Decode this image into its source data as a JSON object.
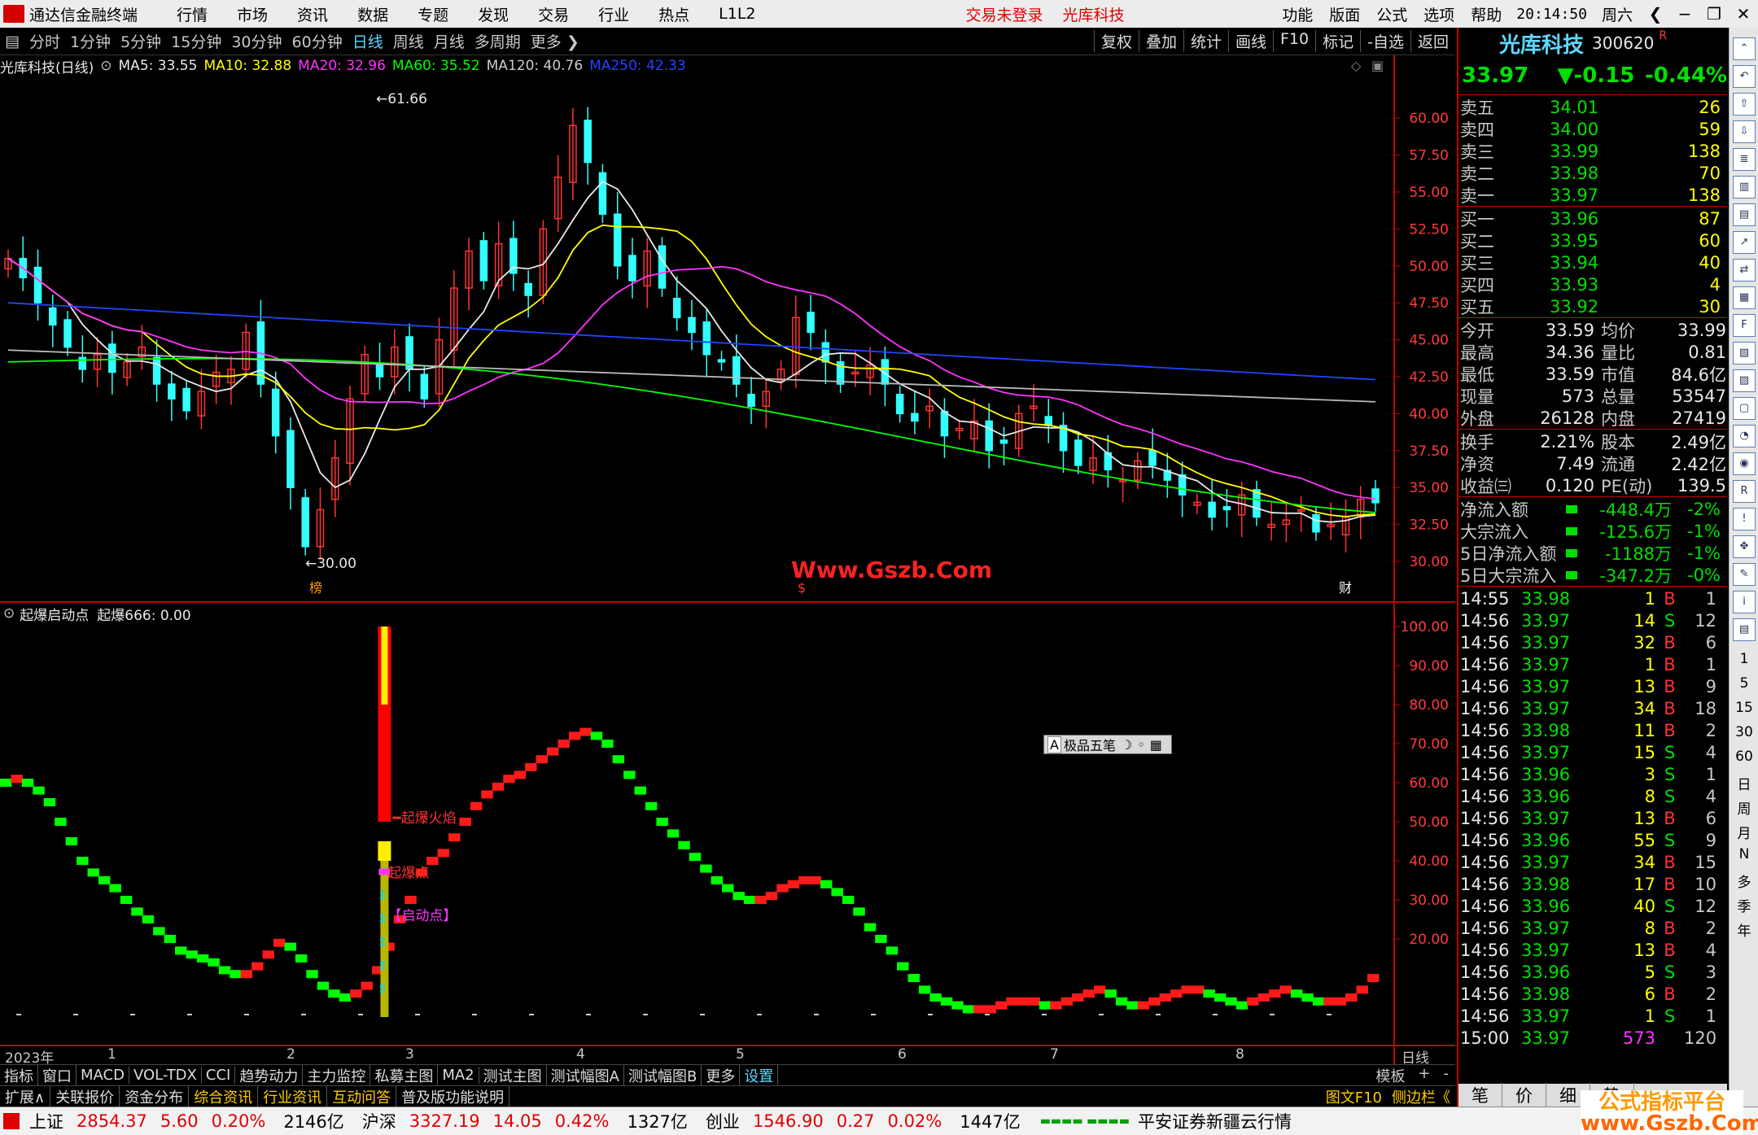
{
  "menubar": {
    "app_title": "通达信金融终端",
    "items": [
      "行情",
      "市场",
      "资讯",
      "数据",
      "专题",
      "发现",
      "交易",
      "行业",
      "热点",
      "L1L2"
    ],
    "status_notice": "交易未登录",
    "stock_name": "光库科技",
    "right_items": [
      "功能",
      "版面",
      "公式",
      "选项",
      "帮助"
    ],
    "clock": "20:14:50",
    "weekday": "周六"
  },
  "periodbar": {
    "periods": [
      "分时",
      "1分钟",
      "5分钟",
      "15分钟",
      "30分钟",
      "60分钟",
      "日线",
      "周线",
      "月线",
      "多周期",
      "更多"
    ],
    "active": "日线",
    "tools": [
      "复权",
      "叠加",
      "统计",
      "画线",
      "F10",
      "标记",
      "-自选",
      "返回"
    ]
  },
  "chart_info": {
    "title": "光库科技(日线)",
    "ma": [
      {
        "label": "MA5: 33.55",
        "color": "#e8e8e8"
      },
      {
        "label": "MA10: 32.88",
        "color": "#ffff00"
      },
      {
        "label": "MA20: 32.96",
        "color": "#ff33ff"
      },
      {
        "label": "MA60: 35.52",
        "color": "#00ff00"
      },
      {
        "label": "MA120: 40.76",
        "color": "#cccccc"
      },
      {
        "label": "MA250: 42.33",
        "color": "#2244ff"
      }
    ]
  },
  "watermark": "Www.Gszb.Com",
  "sub_chart": {
    "title": "起爆启动点",
    "value_label": "起爆666: 0.00",
    "annotations": [
      "起爆火焰",
      "起爆点",
      "【启动点】"
    ],
    "popup": "极品五笔"
  },
  "date_axis": {
    "labels": [
      "2023年",
      "1",
      "2",
      "3",
      "4",
      "5",
      "6",
      "7",
      "8",
      "日线"
    ]
  },
  "tabs1": [
    "指标",
    "窗口",
    "MACD",
    "VOL-TDX",
    "CCI",
    "趋势动力",
    "主力监控",
    "私募主图",
    "MA2",
    "测试主图",
    "测试幅图A",
    "测试幅图B",
    "更多",
    "设置"
  ],
  "tabs1_tail": [
    "模板",
    "+",
    "-"
  ],
  "tabs2": [
    "扩展∧",
    "关联报价",
    "资金分布",
    "综合资讯",
    "行业资讯",
    "互动问答",
    "普及版功能说明"
  ],
  "tabs2_tail": [
    "图文F10",
    "侧边栏《"
  ],
  "quote": {
    "name": "光库科技",
    "code": "300620",
    "price": "33.97",
    "change": "▼-0.15",
    "pct": "-0.44%",
    "asks": [
      {
        "label": "卖五",
        "price": "34.01",
        "vol": "26"
      },
      {
        "label": "卖四",
        "price": "34.00",
        "vol": "59"
      },
      {
        "label": "卖三",
        "price": "33.99",
        "vol": "138"
      },
      {
        "label": "卖二",
        "price": "33.98",
        "vol": "70"
      },
      {
        "label": "卖一",
        "price": "33.97",
        "vol": "138"
      }
    ],
    "bids": [
      {
        "label": "买一",
        "price": "33.96",
        "vol": "87"
      },
      {
        "label": "买二",
        "price": "33.95",
        "vol": "60"
      },
      {
        "label": "买三",
        "price": "33.94",
        "vol": "40"
      },
      {
        "label": "买四",
        "price": "33.93",
        "vol": "4"
      },
      {
        "label": "买五",
        "price": "33.92",
        "vol": "30"
      }
    ],
    "stats": [
      {
        "l1": "今开",
        "v1": "33.59",
        "l2": "均价",
        "v2": "33.99"
      },
      {
        "l1": "最高",
        "v1": "34.36",
        "l2": "量比",
        "v2": "0.81"
      },
      {
        "l1": "最低",
        "v1": "33.59",
        "l2": "市值",
        "v2": "84.6亿"
      },
      {
        "l1": "现量",
        "v1": "573",
        "l2": "总量",
        "v2": "53547"
      },
      {
        "l1": "外盘",
        "v1": "26128",
        "l2": "内盘",
        "v2": "27419"
      }
    ],
    "fund": [
      {
        "l1": "换手",
        "v1": "2.21%",
        "l2": "股本",
        "v2": "2.49亿"
      },
      {
        "l1": "净资",
        "v1": "7.49",
        "l2": "流通",
        "v2": "2.42亿"
      },
      {
        "l1": "收益㈢",
        "v1": "0.120",
        "l2": "PE(动)",
        "v2": "139.5"
      }
    ],
    "flows": [
      {
        "label": "净流入额",
        "value": "-448.4万",
        "pct": "-2%"
      },
      {
        "label": "大宗流入",
        "value": "-125.6万",
        "pct": "-1%"
      },
      {
        "label": "5日净流入额",
        "value": "-1188万",
        "pct": "-1%"
      },
      {
        "label": "5日大宗流入",
        "value": "-347.2万",
        "pct": "-0%"
      }
    ],
    "ticks": [
      {
        "t": "14:55",
        "p": "33.98",
        "v": "1",
        "bs": "B",
        "n": "1"
      },
      {
        "t": "14:56",
        "p": "33.97",
        "v": "14",
        "bs": "S",
        "n": "12"
      },
      {
        "t": "14:56",
        "p": "33.97",
        "v": "32",
        "bs": "B",
        "n": "6"
      },
      {
        "t": "14:56",
        "p": "33.97",
        "v": "1",
        "bs": "B",
        "n": "1"
      },
      {
        "t": "14:56",
        "p": "33.97",
        "v": "13",
        "bs": "B",
        "n": "9"
      },
      {
        "t": "14:56",
        "p": "33.97",
        "v": "34",
        "bs": "B",
        "n": "18"
      },
      {
        "t": "14:56",
        "p": "33.98",
        "v": "11",
        "bs": "B",
        "n": "2"
      },
      {
        "t": "14:56",
        "p": "33.97",
        "v": "15",
        "bs": "S",
        "n": "4"
      },
      {
        "t": "14:56",
        "p": "33.96",
        "v": "3",
        "bs": "S",
        "n": "1"
      },
      {
        "t": "14:56",
        "p": "33.96",
        "v": "8",
        "bs": "S",
        "n": "4"
      },
      {
        "t": "14:56",
        "p": "33.97",
        "v": "13",
        "bs": "B",
        "n": "6"
      },
      {
        "t": "14:56",
        "p": "33.96",
        "v": "55",
        "bs": "S",
        "n": "9"
      },
      {
        "t": "14:56",
        "p": "33.97",
        "v": "34",
        "bs": "B",
        "n": "15"
      },
      {
        "t": "14:56",
        "p": "33.98",
        "v": "17",
        "bs": "B",
        "n": "10"
      },
      {
        "t": "14:56",
        "p": "33.96",
        "v": "40",
        "bs": "S",
        "n": "12"
      },
      {
        "t": "14:56",
        "p": "33.97",
        "v": "8",
        "bs": "B",
        "n": "2"
      },
      {
        "t": "14:56",
        "p": "33.97",
        "v": "13",
        "bs": "B",
        "n": "4"
      },
      {
        "t": "14:56",
        "p": "33.96",
        "v": "5",
        "bs": "S",
        "n": "3"
      },
      {
        "t": "14:56",
        "p": "33.98",
        "v": "6",
        "bs": "B",
        "n": "2"
      },
      {
        "t": "14:56",
        "p": "33.97",
        "v": "1",
        "bs": "S",
        "n": "1"
      },
      {
        "t": "15:00",
        "p": "33.97",
        "v": "573",
        "bs": "",
        "n": "120"
      }
    ],
    "bottom_tabs": [
      "笔",
      "价",
      "细",
      "势"
    ]
  },
  "side_tools": {
    "labels": [
      "1",
      "5",
      "15",
      "30",
      "60",
      "日",
      "周",
      "月",
      "N",
      "多",
      "季",
      "年"
    ]
  },
  "statusbar": {
    "sh": {
      "name": "上证",
      "val": "2854.37",
      "chg": "5.60",
      "pct": "0.20%",
      "amt": "2146亿"
    },
    "sz": {
      "name": "沪深",
      "val": "3327.19",
      "chg": "14.05",
      "pct": "0.42%",
      "amt": "1327亿"
    },
    "cy": {
      "name": "创业",
      "val": "1546.90",
      "chg": "0.27",
      "pct": "0.02%",
      "amt": "1447亿"
    },
    "broker": "平安证券新疆云行情"
  },
  "brand": {
    "line1": "公式指标平台",
    "line2": "www.Gszb.Com"
  },
  "chart_data": [
    {
      "type": "candlestick",
      "title": "光库科技(日线)",
      "ylim": [
        30.0,
        61.66
      ],
      "y_ticks": [
        "60.00",
        "57.50",
        "55.00",
        "52.50",
        "50.00",
        "47.50",
        "45.00",
        "42.50",
        "40.00",
        "37.50",
        "35.00",
        "32.50",
        "30.00"
      ],
      "high_label": "61.66",
      "low_label": "30.00",
      "markers": [
        "榜",
        "$",
        "财"
      ],
      "close_path": [
        50.5,
        49.2,
        47.5,
        46.0,
        44.5,
        43.0,
        44.0,
        42.8,
        43.5,
        44.5,
        42.0,
        41.0,
        40.2,
        41.5,
        42.8,
        43.0,
        45.5,
        42.0,
        38.5,
        35.0,
        31.0,
        33.5,
        37.0,
        41.0,
        44.0,
        42.5,
        44.5,
        43.0,
        41.0,
        45.0,
        48.5,
        51.0,
        49.0,
        51.5,
        49.5,
        48.0,
        52.5,
        56.0,
        59.5,
        57.0,
        53.5,
        50.0,
        49.0,
        51.0,
        48.5,
        46.5,
        45.5,
        44.0,
        43.5,
        42.0,
        40.5,
        41.5,
        43.0,
        46.5,
        45.5,
        43.5,
        42.0,
        42.8,
        43.3,
        42.0,
        40.0,
        39.5,
        40.5,
        38.5,
        39.0,
        39.5,
        37.5,
        38.0,
        40.0,
        40.5,
        39.2,
        37.5,
        36.5,
        37.0,
        36.2,
        35.5,
        36.8,
        36.5,
        35.5,
        34.5,
        34.0,
        33.0,
        33.5,
        34.5,
        33.0,
        32.5,
        32.8,
        33.5,
        32.0,
        32.5,
        33.0,
        34.2,
        33.97
      ],
      "ma_series": [
        {
          "name": "MA5",
          "color": "#e8e8e8"
        },
        {
          "name": "MA10",
          "color": "#ffff00"
        },
        {
          "name": "MA20",
          "color": "#ff33ff"
        },
        {
          "name": "MA60",
          "color": "#00ff00"
        },
        {
          "name": "MA120",
          "color": "#bbbbbb"
        },
        {
          "name": "MA250",
          "color": "#2244ff"
        }
      ]
    },
    {
      "type": "line",
      "title": "起爆启动点",
      "ylim": [
        0,
        100
      ],
      "y_ticks": [
        "100.00",
        "90.00",
        "80.00",
        "70.00",
        "60.00",
        "50.00",
        "40.00",
        "30.00",
        "20.00"
      ],
      "values": [
        60,
        61,
        60,
        58,
        55,
        50,
        45,
        40,
        37,
        35,
        33,
        30,
        27,
        25,
        22,
        20,
        17,
        16,
        15,
        14,
        12,
        11,
        11,
        13,
        16,
        19,
        18,
        15,
        11,
        8,
        6,
        5,
        6,
        8,
        12,
        18,
        25,
        30,
        37,
        40,
        42,
        46,
        50,
        54,
        57,
        59,
        61,
        62,
        64,
        66,
        68,
        70,
        72,
        73,
        72,
        70,
        66,
        62,
        58,
        54,
        50,
        47,
        44,
        41,
        38,
        35,
        33,
        31,
        30,
        30,
        31,
        33,
        34,
        35,
        35,
        34,
        32,
        30,
        27,
        23,
        20,
        17,
        13,
        10,
        7,
        5,
        4,
        3,
        2,
        2,
        2,
        3,
        4,
        4,
        4,
        3,
        3,
        4,
        5,
        6,
        7,
        6,
        4,
        3,
        3,
        4,
        5,
        6,
        7,
        7,
        6,
        5,
        4,
        3,
        4,
        5,
        6,
        7,
        6,
        5,
        4,
        4,
        4,
        5,
        7,
        10
      ],
      "up_color": "#ff1a1a",
      "down_color": "#00ff00",
      "spike_value": 100
    }
  ]
}
